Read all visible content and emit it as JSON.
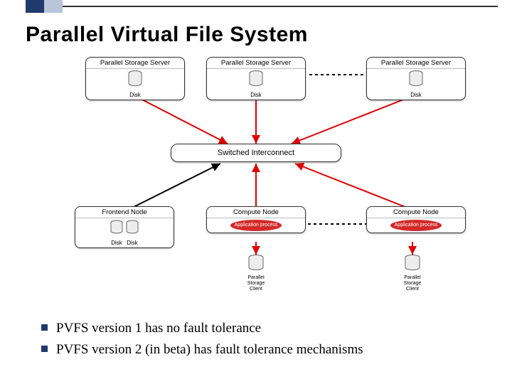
{
  "slide": {
    "title": "Parallel Virtual File System"
  },
  "diagram": {
    "servers": {
      "pss": "Parallel Storage Server",
      "disk": "Disk",
      "frontend": "Frontend Node",
      "compute": "Compute Node",
      "app": "Application process",
      "psc": "Parallel\nStorage\nClient"
    },
    "switch": "Switched Interconnect"
  },
  "bullets": [
    "PVFS version 1 has no fault tolerance",
    "PVFS version 2 (in beta) has fault tolerance mechanisms"
  ]
}
